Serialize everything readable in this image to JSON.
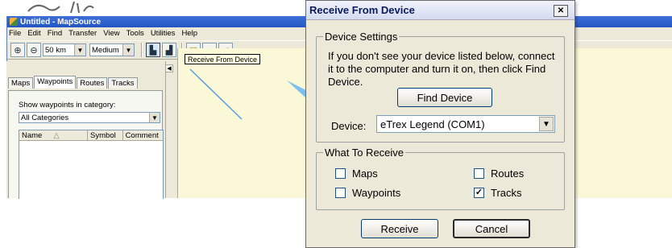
{
  "app": {
    "title": "Untitled - MapSource",
    "menu": [
      "File",
      "Edit",
      "Find",
      "Transfer",
      "View",
      "Tools",
      "Utilities",
      "Help"
    ],
    "toolbar": {
      "scale_value": "50 km",
      "detail_value": "Medium",
      "tooltip": "Receive From Device"
    },
    "tabs": [
      "Maps",
      "Waypoints",
      "Routes",
      "Tracks"
    ],
    "active_tab": "Waypoints",
    "category_label": "Show waypoints in category:",
    "category_value": "All Categories",
    "columns": [
      "Name",
      "Symbol",
      "Comment"
    ]
  },
  "dialog": {
    "title": "Receive From Device",
    "close_glyph": "✕",
    "device_settings": {
      "legend": "Device Settings",
      "message": "If you don't see your device listed below, connect it to the computer and turn it on, then click Find Device.",
      "find_button": "Find Device",
      "device_label": "Device:",
      "device_value": "eTrex Legend (COM1)"
    },
    "what_to_receive": {
      "legend": "What To Receive",
      "options": [
        {
          "label": "Maps",
          "checked": false
        },
        {
          "label": "Routes",
          "checked": false
        },
        {
          "label": "Waypoints",
          "checked": false
        },
        {
          "label": "Tracks",
          "checked": true
        }
      ]
    },
    "receive_button": "Receive",
    "cancel_button": "Cancel"
  },
  "colors": {
    "titlebar": "#2456c4",
    "dialog_bg": "#ece9d8",
    "map_bg": "#fbf8d8",
    "annotation_line": "#5a9fe0"
  }
}
